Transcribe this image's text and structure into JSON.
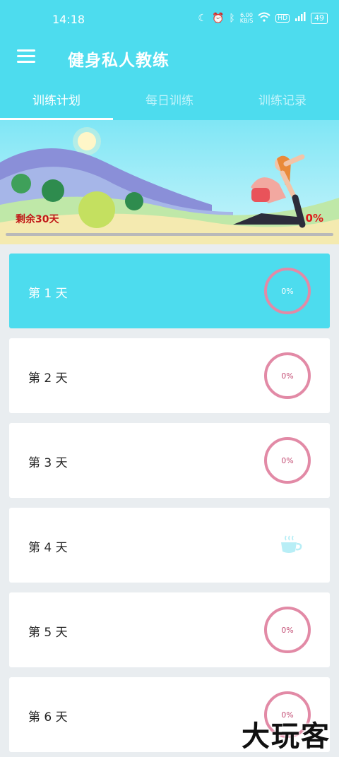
{
  "status_bar": {
    "time": "14:18",
    "net_speed": "6.00\nKB/S",
    "battery": "49"
  },
  "app_bar": {
    "title": "健身私人教练"
  },
  "tabs": [
    "训练计划",
    "每日训练",
    "训练记录"
  ],
  "banner": {
    "remaining": "剩余30天",
    "percent": "0%",
    "progress": 0
  },
  "days": [
    {
      "label": "第 1 天",
      "status": "0%"
    },
    {
      "label": "第 2 天",
      "status": "0%"
    },
    {
      "label": "第 3 天",
      "status": "0%"
    },
    {
      "label": "第 4 天",
      "status": "rest"
    },
    {
      "label": "第 5 天",
      "status": "0%"
    },
    {
      "label": "第 6 天",
      "status": "0%"
    }
  ],
  "watermark": "大玩客",
  "colors": {
    "accent": "#4ddcee",
    "ring": "#e28aa6",
    "remaining_text": "#c01818"
  }
}
